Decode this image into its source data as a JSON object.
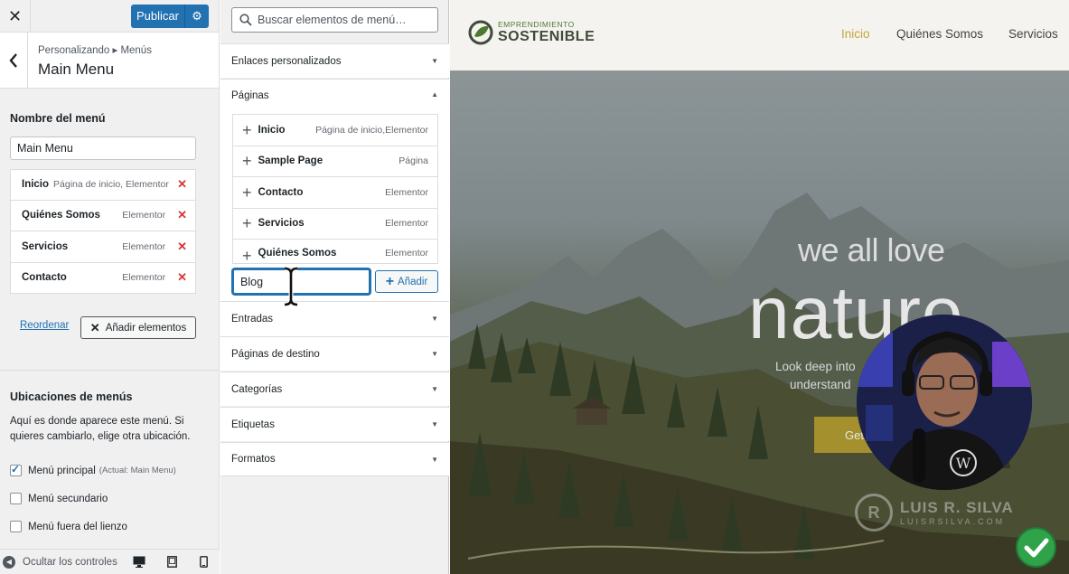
{
  "topbar": {
    "close_glyph": "✕",
    "publish_label": "Publicar",
    "publish_gear": "⚙"
  },
  "section": {
    "breadcrumb": "Personalizando ▸ Menús",
    "title": "Main Menu",
    "back_glyph": "‹"
  },
  "menu_name": {
    "label": "Nombre del menú",
    "value": "Main Menu"
  },
  "menu_items": [
    {
      "title": "Inicio",
      "type": "Página de inicio, Elementor"
    },
    {
      "title": "Quiénes Somos",
      "type": "Elementor"
    },
    {
      "title": "Servicios",
      "type": "Elementor"
    },
    {
      "title": "Contacto",
      "type": "Elementor"
    }
  ],
  "remove_glyph": "✕",
  "reorder_label": "Reordenar",
  "add_items_label": "Añadir elementos",
  "locations": {
    "title": "Ubicaciones de menús",
    "description": "Aquí es donde aparece este menú. Si quieres cambiarlo, elige otra ubicación.",
    "options": [
      {
        "label": "Menú principal",
        "note": "(Actual: Main Menu)",
        "checked": true
      },
      {
        "label": "Menú secundario",
        "note": "",
        "checked": false
      },
      {
        "label": "Menú fuera del lienzo",
        "note": "",
        "checked": false
      }
    ]
  },
  "footer": {
    "hide_controls": "Ocultar los controles",
    "devices": [
      "desktop-icon",
      "tablet-icon",
      "mobile-icon"
    ]
  },
  "add_panel": {
    "search_placeholder": "Buscar elementos de menú…",
    "sections": {
      "custom_links": "Enlaces personalizados",
      "pages": "Páginas",
      "posts": "Entradas",
      "landing_pages": "Páginas de destino",
      "categories": "Categorías",
      "tags": "Etiquetas",
      "formats": "Formatos"
    },
    "pages_list": [
      {
        "title": "Inicio",
        "type": "Página de inicio,Elementor"
      },
      {
        "title": "Sample Page",
        "type": "Página"
      },
      {
        "title": "Contacto",
        "type": "Elementor"
      },
      {
        "title": "Servicios",
        "type": "Elementor"
      },
      {
        "title": "Quiénes Somos",
        "type": "Elementor"
      }
    ],
    "custom_input_value": "Blog",
    "add_button_label": "Añadir"
  },
  "preview": {
    "logo_line1": "EMPRENDIMIENTO",
    "logo_line2": "SOSTENIBLE",
    "nav": [
      "Inicio",
      "Quiénes Somos",
      "Servicios"
    ],
    "active_nav": "Inicio",
    "hero_kicker": "we all love",
    "hero_title": "nature",
    "hero_sub1": "Look deep into",
    "hero_sub2": "understand",
    "hero_cta": "Get",
    "watermark_name": "LUIS R. SILVA",
    "watermark_site": "LUISRSILVA.COM"
  },
  "colors": {
    "wp_blue": "#2271b1",
    "danger": "#d63638",
    "brand_gold": "#c8a43a",
    "check_green": "#2fa24a"
  }
}
